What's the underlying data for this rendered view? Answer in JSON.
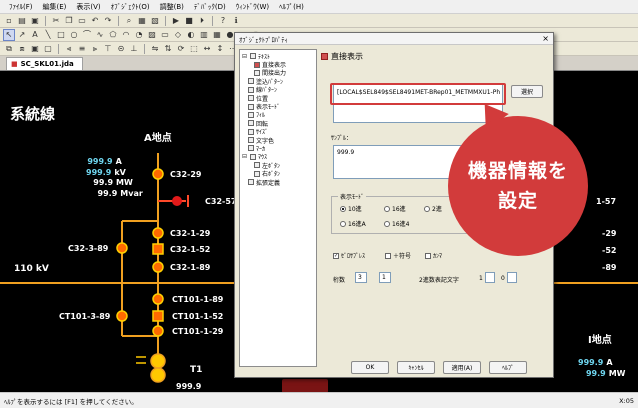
{
  "menu": [
    "ﾌｧｲﾙ(F)",
    "編集(E)",
    "表示(V)",
    "ｵﾌﾞｼﾞｪｸﾄ(O)",
    "調整(B)",
    "ﾃﾞﾊﾞｯｸ(D)",
    "ｳｨﾝﾄﾞｳ(W)",
    "ﾍﾙﾌﾟ(H)"
  ],
  "document_tab": "SC_SKL01.jda",
  "canvas": {
    "title": "系統線",
    "point_a": "A地点",
    "point_i": "I地点",
    "voltage": "110 kV",
    "transformer": "T1",
    "measurements": [
      {
        "value": "999.9",
        "unit": "A"
      },
      {
        "value": "999.9",
        "unit": "kV"
      },
      {
        "value": "99.9",
        "unit": "MW"
      },
      {
        "value": "99.9",
        "unit": "Mvar"
      }
    ],
    "left_labels": {
      "c1": "C32-3-89",
      "c2": "CT101-3-89"
    },
    "right_labels": [
      "C32-29",
      "C32-57",
      "C32-1-29",
      "C32-1-52",
      "C32-1-89",
      "CT101-1-89",
      "CT101-1-52",
      "CT101-1-29"
    ],
    "right_edge_labels": [
      "1-57",
      "-29",
      "-52",
      "-89"
    ],
    "i_measurements": [
      {
        "value": "999.9",
        "unit": "A"
      },
      {
        "value": "99.9",
        "unit": "MW"
      }
    ],
    "t1_value": "999.9"
  },
  "dialog": {
    "title": "ｵﾌﾞｼﾞｪｸﾄﾌﾟﾛﾊﾟﾃｨ",
    "close": "×",
    "tree": [
      "ﾃｷｽﾄ",
      "直接表示",
      "間接出力",
      "塗込ﾊﾟﾀｰﾝ",
      "線ﾊﾟﾀｰﾝ",
      "位置",
      "表示ﾓｰﾄﾞ",
      "ﾌｨﾙ",
      "回転",
      "ｻｲｽﾞ",
      "文字色",
      "ﾏｰｶ",
      "ﾏｳｽ",
      "左ﾎﾞﾀﾝ",
      "右ﾎﾞﾀﾝ",
      "拡張定義"
    ],
    "panel_title": "直接表示",
    "path_value": "[LOCAL$SEL849$SEL8491MET-BRep01_METMMXU1-Ph",
    "browse_button": "選択",
    "sample_label": "ｻﾝﾌﾟﾙ：",
    "sample_value": "999.9",
    "mode_label": "表示ﾓｰﾄﾞ",
    "radios": [
      "10進",
      "16進",
      "2進",
      "16進A",
      "16進4"
    ],
    "checks": [
      "ｾﾞﾛｻﾌﾟﾚｽ",
      "＋符号",
      "ｶﾝﾏ"
    ],
    "digits_label": "桁数",
    "digits_value": "3",
    "decimals_value": "1",
    "extra_label": "2進数表記文字",
    "extra_1": "1",
    "extra_0": "0",
    "buttons": {
      "ok": "OK",
      "cancel": "ｷｬﾝｾﾙ",
      "apply": "適用(A)",
      "help": "ﾍﾙﾌﾟ"
    }
  },
  "callout": {
    "line1": "機器情報を",
    "line2": "設定"
  },
  "status": {
    "left": "ﾍﾙﾌﾟを表示するには [F1] を押してください。",
    "right": "X:05"
  },
  "colors": {
    "accent": "#d23b3b",
    "bus": "#f0a020",
    "breaker": "#ff6a00"
  }
}
